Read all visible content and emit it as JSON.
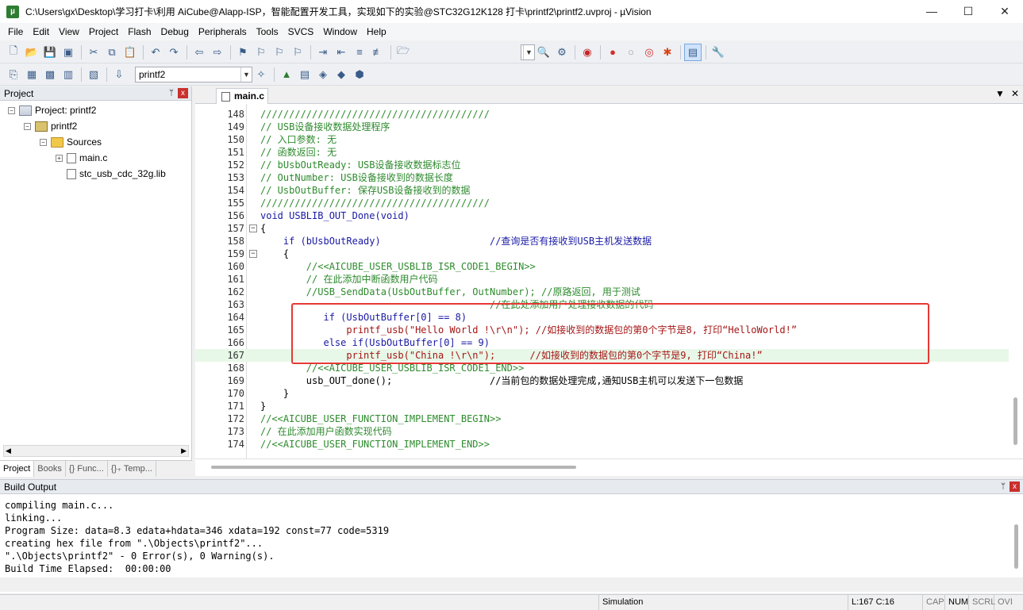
{
  "window": {
    "title": "C:\\Users\\gx\\Desktop\\学习打卡\\利用 AiCube@Alapp-ISP，智能配置开发工具，实现如下的实验@STC32G12K128 打卡\\printf2\\printf2.uvproj - µVision",
    "app_icon": "µ",
    "minimize": "—",
    "maximize": "☐",
    "close": "✕"
  },
  "menu": [
    "File",
    "Edit",
    "View",
    "Project",
    "Flash",
    "Debug",
    "Peripherals",
    "Tools",
    "SVCS",
    "Window",
    "Help"
  ],
  "toolbar2": {
    "target_combo": "printf2"
  },
  "project_panel": {
    "title": "Project",
    "pin": "ᛘ",
    "close": "x",
    "tree": [
      {
        "label": "Project: printf2",
        "level": 0,
        "icon": "project-icon",
        "expander": "−"
      },
      {
        "label": "printf2",
        "level": 1,
        "icon": "target-icon",
        "expander": "−"
      },
      {
        "label": "Sources",
        "level": 2,
        "icon": "folder-icon",
        "expander": "−"
      },
      {
        "label": "main.c",
        "level": 3,
        "icon": "file-icon",
        "expander": "+"
      },
      {
        "label": "stc_usb_cdc_32g.lib",
        "level": 3,
        "icon": "file-icon",
        "expander": ""
      }
    ],
    "tabs": [
      "Project",
      "Books",
      "{} Func...",
      "{}₊ Temp..."
    ]
  },
  "editor": {
    "tab_label": "main.c",
    "menu_arrow": "▼",
    "close": "✕",
    "lines": [
      {
        "n": "148",
        "code": "////////////////////////////////////////"
      },
      {
        "n": "149",
        "code": "// USB设备接收数据处理程序"
      },
      {
        "n": "150",
        "code": "// 入口参数: 无"
      },
      {
        "n": "151",
        "code": "// 函数返回: 无"
      },
      {
        "n": "152",
        "code": "// bUsbOutReady: USB设备接收数据标志位"
      },
      {
        "n": "153",
        "code": "// OutNumber: USB设备接收到的数据长度"
      },
      {
        "n": "154",
        "code": "// UsbOutBuffer: 保存USB设备接收到的数据"
      },
      {
        "n": "155",
        "code": "////////////////////////////////////////"
      },
      {
        "n": "156",
        "code": "void USBLIB_OUT_Done(void)"
      },
      {
        "n": "157",
        "code": "{"
      },
      {
        "n": "158",
        "code": "    if (bUsbOutReady)                   //查询是否有接收到USB主机发送数据"
      },
      {
        "n": "159",
        "code": "    {"
      },
      {
        "n": "160",
        "code": "        //<<AICUBE_USER_USBLIB_ISR_CODE1_BEGIN>>"
      },
      {
        "n": "161",
        "code": "        // 在此添加中断函数用户代码"
      },
      {
        "n": "162",
        "code": "        //USB_SendData(UsbOutBuffer, OutNumber); //原路返回, 用于测试"
      },
      {
        "n": "163",
        "code": "                                        //在此处添加用户处理接收数据的代码"
      },
      {
        "n": "164",
        "code": "           if (UsbOutBuffer[0] == 8)"
      },
      {
        "n": "165",
        "code": "               printf_usb(\"Hello World !\\r\\n\"); //如接收到的数据包的第0个字节是8, 打印“HelloWorld!”"
      },
      {
        "n": "166",
        "code": "           else if(UsbOutBuffer[0] == 9)"
      },
      {
        "n": "167",
        "code": "               printf_usb(\"China !\\r\\n\");      //如接收到的数据包的第0个字节是9, 打印“China!”"
      },
      {
        "n": "168",
        "code": "        //<<AICUBE_USER_USBLIB_ISR_CODE1_END>>"
      },
      {
        "n": "169",
        "code": "        usb_OUT_done();                 //当前包的数据处理完成,通知USB主机可以发送下一包数据"
      },
      {
        "n": "170",
        "code": "    }"
      },
      {
        "n": "171",
        "code": "}"
      },
      {
        "n": "172",
        "code": "//<<AICUBE_USER_FUNCTION_IMPLEMENT_BEGIN>>"
      },
      {
        "n": "173",
        "code": "// 在此添加用户函数实现代码"
      },
      {
        "n": "174",
        "code": "//<<AICUBE_USER_FUNCTION_IMPLEMENT_END>>"
      }
    ]
  },
  "build_output": {
    "title": "Build Output",
    "pin": "ᛘ",
    "close": "x",
    "lines": [
      "compiling main.c...",
      "linking...",
      "Program Size: data=8.3 edata+hdata=346 xdata=192 const=77 code=5319",
      "creating hex file from \".\\Objects\\printf2\"...",
      "\".\\Objects\\printf2\" - 0 Error(s), 0 Warning(s).",
      "Build Time Elapsed:  00:00:00"
    ]
  },
  "statusbar": {
    "mode": "Simulation",
    "cursor": "L:167 C:16",
    "caps": "CAP",
    "num": "NUM",
    "scrl": "SCRL",
    "ovr": "OVI"
  },
  "colors": {
    "comment": "#2e8b2e",
    "keyword": "#1a1aa6",
    "string": "#a51515",
    "highlight": "#e53935"
  }
}
